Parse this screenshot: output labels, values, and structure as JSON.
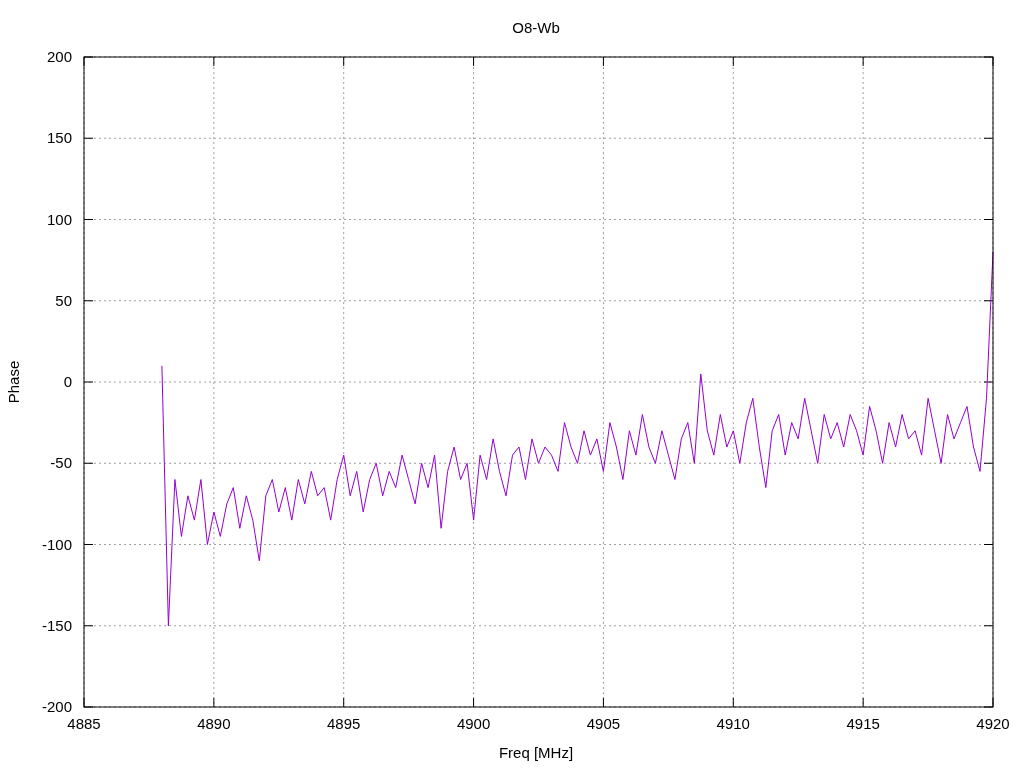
{
  "chart_data": {
    "type": "line",
    "title": "O8-Wb",
    "xlabel": "Freq [MHz]",
    "ylabel": "Phase",
    "x": [
      4888,
      4888.25,
      4888.5,
      4888.75,
      4889,
      4889.25,
      4889.5,
      4889.75,
      4890,
      4890.25,
      4890.5,
      4890.75,
      4891,
      4891.25,
      4891.5,
      4891.75,
      4892,
      4892.25,
      4892.5,
      4892.75,
      4893,
      4893.25,
      4893.5,
      4893.75,
      4894,
      4894.25,
      4894.5,
      4894.75,
      4895,
      4895.25,
      4895.5,
      4895.75,
      4896,
      4896.25,
      4896.5,
      4896.75,
      4897,
      4897.25,
      4897.5,
      4897.75,
      4898,
      4898.25,
      4898.5,
      4898.75,
      4899,
      4899.25,
      4899.5,
      4899.75,
      4900,
      4900.25,
      4900.5,
      4900.75,
      4901,
      4901.25,
      4901.5,
      4901.75,
      4902,
      4902.25,
      4902.5,
      4902.75,
      4903,
      4903.25,
      4903.5,
      4903.75,
      4904,
      4904.25,
      4904.5,
      4904.75,
      4905,
      4905.25,
      4905.5,
      4905.75,
      4906,
      4906.25,
      4906.5,
      4906.75,
      4907,
      4907.25,
      4907.5,
      4907.75,
      4908,
      4908.25,
      4908.5,
      4908.75,
      4909,
      4909.25,
      4909.5,
      4909.75,
      4910,
      4910.25,
      4910.5,
      4910.75,
      4911,
      4911.25,
      4911.5,
      4911.75,
      4912,
      4912.25,
      4912.5,
      4912.75,
      4913,
      4913.25,
      4913.5,
      4913.75,
      4914,
      4914.25,
      4914.5,
      4914.75,
      4915,
      4915.25,
      4915.5,
      4915.75,
      4916,
      4916.25,
      4916.5,
      4916.75,
      4917,
      4917.25,
      4917.5,
      4917.75,
      4918,
      4918.25,
      4918.5,
      4918.75,
      4919,
      4919.25,
      4919.5,
      4919.75,
      4920
    ],
    "grid": true,
    "series": [
      {
        "color": "#9400d3",
        "values": [
          10,
          -150,
          -60,
          -95,
          -70,
          -85,
          -60,
          -100,
          -80,
          -95,
          -75,
          -65,
          -90,
          -70,
          -85,
          -110,
          -70,
          -60,
          -80,
          -65,
          -85,
          -60,
          -75,
          -55,
          -70,
          -65,
          -85,
          -60,
          -45,
          -70,
          -55,
          -80,
          -60,
          -50,
          -70,
          -55,
          -65,
          -45,
          -60,
          -75,
          -50,
          -65,
          -45,
          -90,
          -55,
          -40,
          -60,
          -50,
          -85,
          -45,
          -60,
          -35,
          -55,
          -70,
          -45,
          -40,
          -60,
          -35,
          -50,
          -40,
          -45,
          -55,
          -25,
          -40,
          -50,
          -30,
          -45,
          -35,
          -55,
          -25,
          -40,
          -60,
          -30,
          -45,
          -20,
          -40,
          -50,
          -30,
          -45,
          -60,
          -35,
          -25,
          -50,
          5,
          -30,
          -45,
          -20,
          -40,
          -30,
          -50,
          -25,
          -10,
          -40,
          -65,
          -30,
          -20,
          -45,
          -25,
          -35,
          -10,
          -30,
          -50,
          -20,
          -35,
          -25,
          -40,
          -20,
          -30,
          -45,
          -15,
          -30,
          -50,
          -25,
          -40,
          -20,
          -35,
          -30,
          -45,
          -10,
          -30,
          -50,
          -20,
          -35,
          -25,
          -15,
          -40,
          -55,
          -10,
          80
        ]
      }
    ],
    "xlim": [
      4885,
      4920
    ],
    "ylim": [
      -200,
      200
    ],
    "xticks": [
      4885,
      4890,
      4895,
      4900,
      4905,
      4910,
      4915,
      4920
    ],
    "yticks": [
      -200,
      -150,
      -100,
      -50,
      0,
      50,
      100,
      150,
      200
    ]
  }
}
